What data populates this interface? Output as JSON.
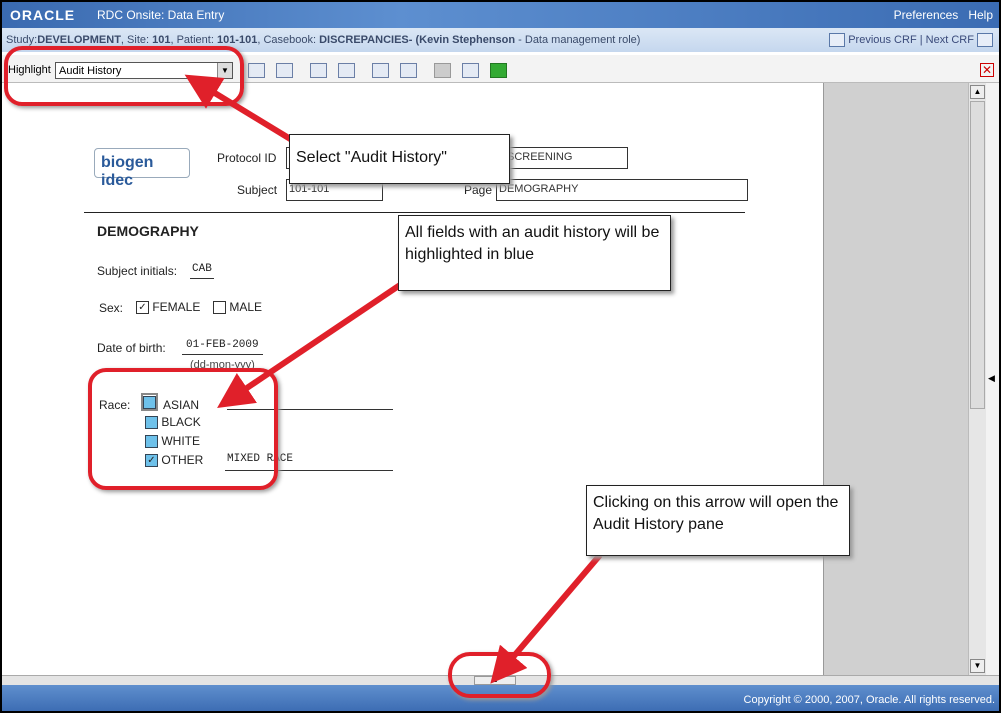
{
  "header": {
    "logo": "ORACLE",
    "app_title": "RDC Onsite: Data Entry",
    "links": [
      "Preferences",
      "Help"
    ]
  },
  "study_bar": {
    "study_label": "Study:",
    "study": "DEVELOPMENT",
    "site_label": ", Site:",
    "site": "101",
    "patient_label": ", Patient:",
    "patient": "101-101",
    "casebook_label": ", Casebook:",
    "casebook": "DISCREPANCIES-",
    "user": "(Kevin Stephenson",
    "role": " - Data management role)",
    "previous_crf": "Previous CRF",
    "next_crf": "Next CRF"
  },
  "toolbar": {
    "highlight_label": "Highlight",
    "highlight_value": "Audit History"
  },
  "form": {
    "logo_text": "biogen idec",
    "protocol_label": "Protocol ID",
    "visit_value": "SCREENING",
    "subject_label": "Subject",
    "subject_value": "101-101",
    "page_label": "Page",
    "page_value": "DEMOGRAPHY",
    "section_title": "DEMOGRAPHY",
    "initials_label": "Subject initials:",
    "initials_value": "CAB",
    "sex_label": "Sex:",
    "sex_options": [
      {
        "label": "FEMALE",
        "checked": true
      },
      {
        "label": "MALE",
        "checked": false
      }
    ],
    "dob_label": "Date of birth:",
    "dob_value": "01-FEB-2009",
    "dob_format": "(dd-mon-yyy)",
    "race_label": "Race:",
    "race_options": [
      {
        "label": "ASIAN",
        "checked": false
      },
      {
        "label": "BLACK",
        "checked": false
      },
      {
        "label": "WHITE",
        "checked": false
      },
      {
        "label": "OTHER",
        "checked": true
      }
    ],
    "race_other_value": "MIXED RACE",
    "audit_highlight_color": "#6ec1ea"
  },
  "callouts": [
    "Select \"Audit History\"",
    "All fields with an audit history will be highlighted in blue",
    "Clicking on this arrow will open the Audit History pane"
  ],
  "annotation_color": "#e0202a",
  "footer": {
    "copyright": "Copyright © 2000, 2007, Oracle. All rights reserved."
  }
}
